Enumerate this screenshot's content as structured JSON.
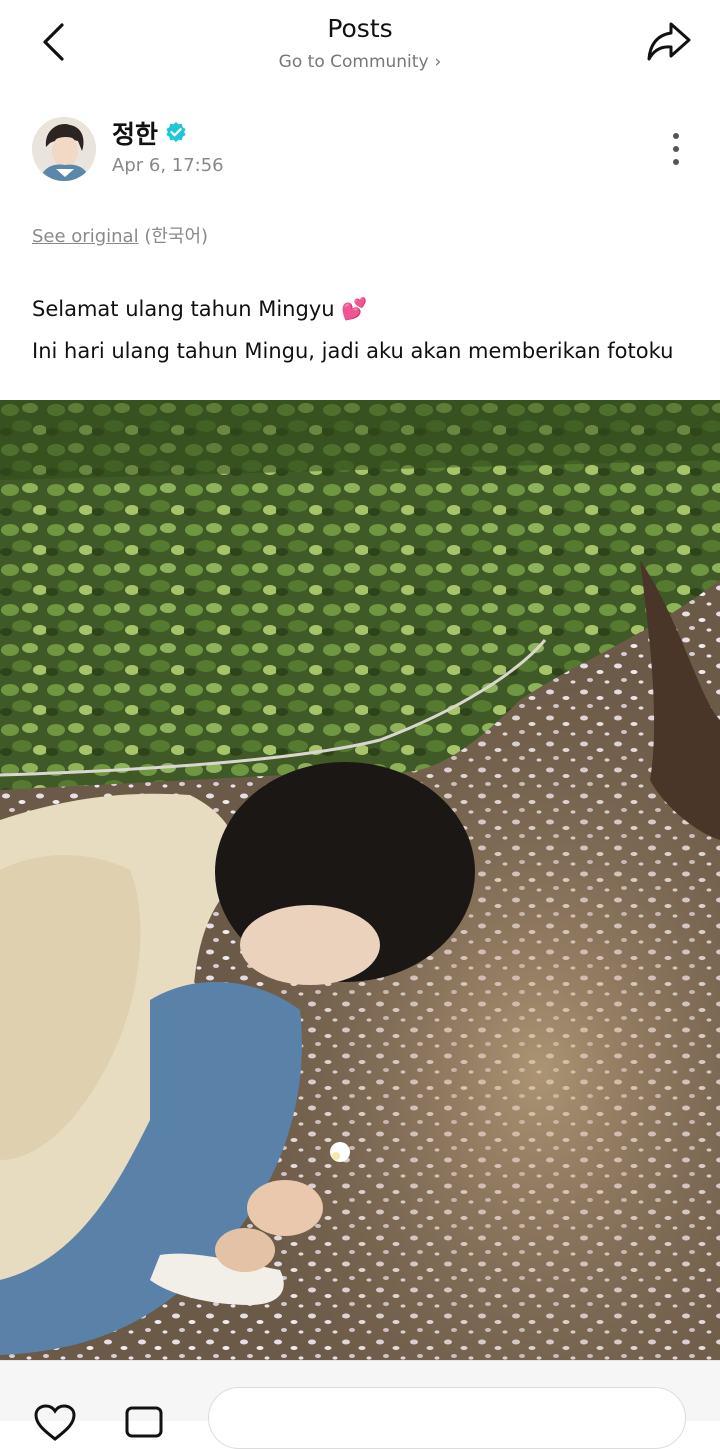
{
  "header": {
    "title": "Posts",
    "community_link": "Go to Community",
    "back_icon": "chevron-left-icon",
    "share_icon": "share-arrow-icon"
  },
  "post": {
    "author_name": "정한",
    "verified_icon": "verified-badge-icon",
    "timestamp": "Apr 6, 17:56",
    "more_icon": "more-vertical-icon",
    "see_original": "See original",
    "original_language": "(한국어)",
    "lines": [
      "Selamat ulang tahun Mingyu 💕",
      "Ini hari ulang tahun Mingu, jadi aku akan memberikan fotoku"
    ]
  },
  "bottom": {
    "like_icon": "heart-icon",
    "comment_icon": "comment-icon",
    "comment_placeholder": ""
  },
  "colors": {
    "verified": "#1ec7d6",
    "muted_text": "#888888"
  }
}
